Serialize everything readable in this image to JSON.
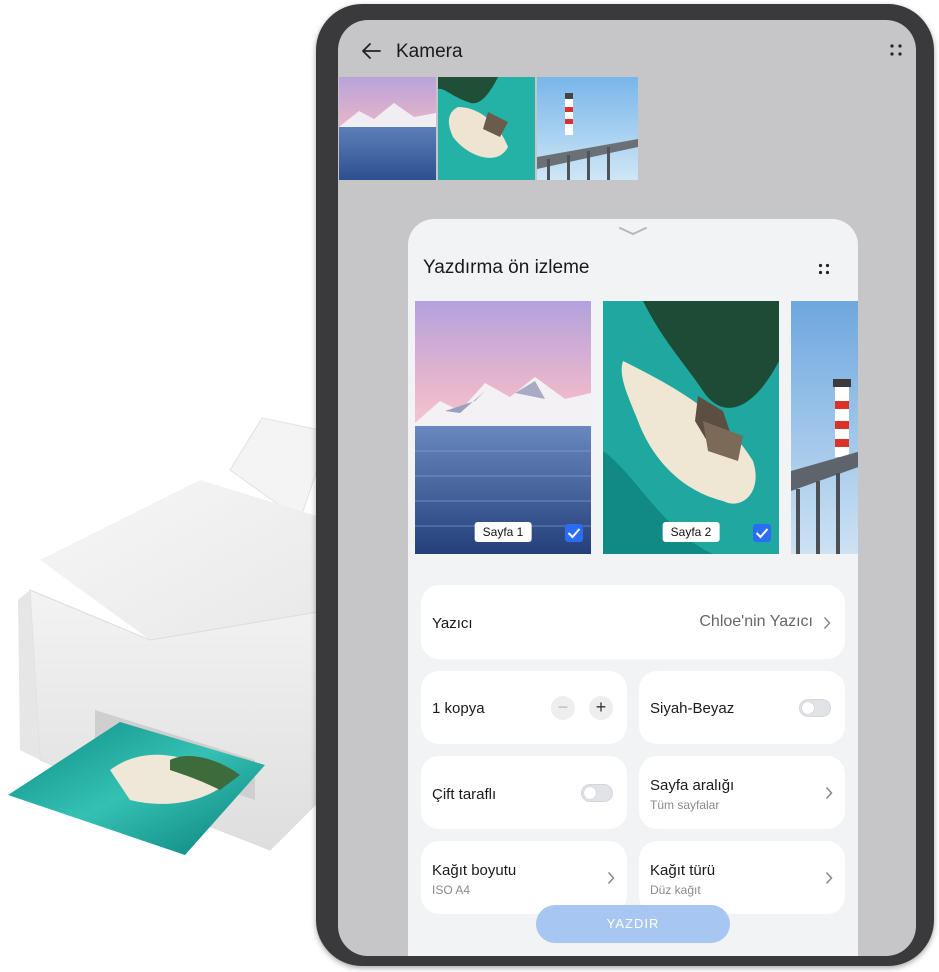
{
  "app": {
    "title": "Kamera"
  },
  "sheet": {
    "title": "Yazdırma ön izleme",
    "pages": [
      {
        "label": "Sayfa 1",
        "checked": true
      },
      {
        "label": "Sayfa 2",
        "checked": true
      }
    ]
  },
  "settings": {
    "printer": {
      "label": "Yazıcı",
      "value": "Chloe'nin Yazıcı"
    },
    "copies": {
      "label": "1 kopya",
      "minus": "−",
      "plus": "+"
    },
    "bw": {
      "label": "Siyah-Beyaz",
      "on": false
    },
    "duplex": {
      "label": "Çift taraflı",
      "on": false
    },
    "page_range": {
      "label": "Sayfa aralığı",
      "value": "Tüm sayfalar"
    },
    "paper_size": {
      "label": "Kağıt boyutu",
      "value": "ISO A4"
    },
    "paper_type": {
      "label": "Kağıt türü",
      "value": "Düz kağıt"
    }
  },
  "print_button": {
    "label": "YAZDIR"
  },
  "icons": [
    "back-arrow-icon",
    "more-icon",
    "chevron-down-icon",
    "chevron-right-icon",
    "checkmark-icon",
    "minus-icon",
    "plus-icon"
  ],
  "colors": {
    "accent": "#2b6df2",
    "print_button": "#a8c6f2",
    "sheet_bg": "#f1f3f5",
    "screen_bg": "#c6c6c8"
  }
}
